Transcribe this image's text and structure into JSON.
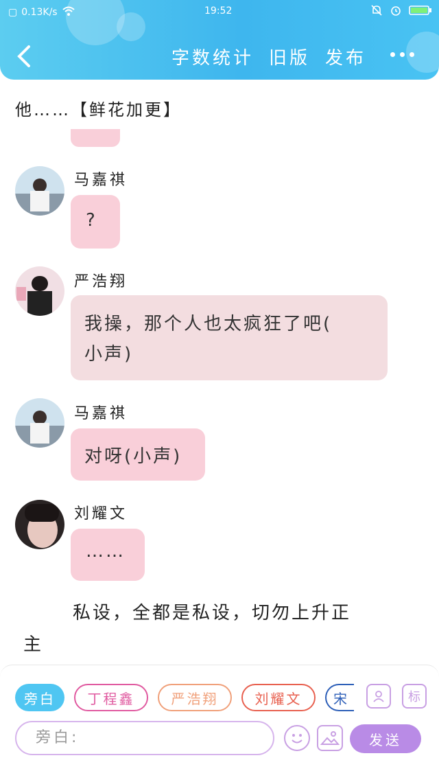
{
  "status_bar": {
    "speed": "0.13K/s",
    "time": "19:52"
  },
  "header": {
    "actions": [
      "字数统计",
      "旧版",
      "发布"
    ]
  },
  "story": {
    "top_line": "他……【鲜花加更】",
    "messages": [
      {
        "speaker": "马嘉祺",
        "text": "?"
      },
      {
        "speaker": "严浩翔",
        "line1": "我操，那个人也太疯狂了吧(",
        "line2": "小声)"
      },
      {
        "speaker": "马嘉祺",
        "text": "对呀(小声)"
      },
      {
        "speaker": "刘耀文",
        "text": "……"
      }
    ],
    "narration_line1": "私设，全都是私设，切勿上升正",
    "narration_line2": "主"
  },
  "composer": {
    "chips": [
      "旁白",
      "丁程鑫",
      "严浩翔",
      "刘耀文",
      "宋"
    ],
    "tag_icon_label": "标",
    "input_placeholder": "旁白:",
    "send_label": "发送"
  },
  "colors": {
    "header_blue": "#3eb6ee",
    "bubble_pink": "#f9cfd9",
    "accent_purple": "#b98be6"
  }
}
